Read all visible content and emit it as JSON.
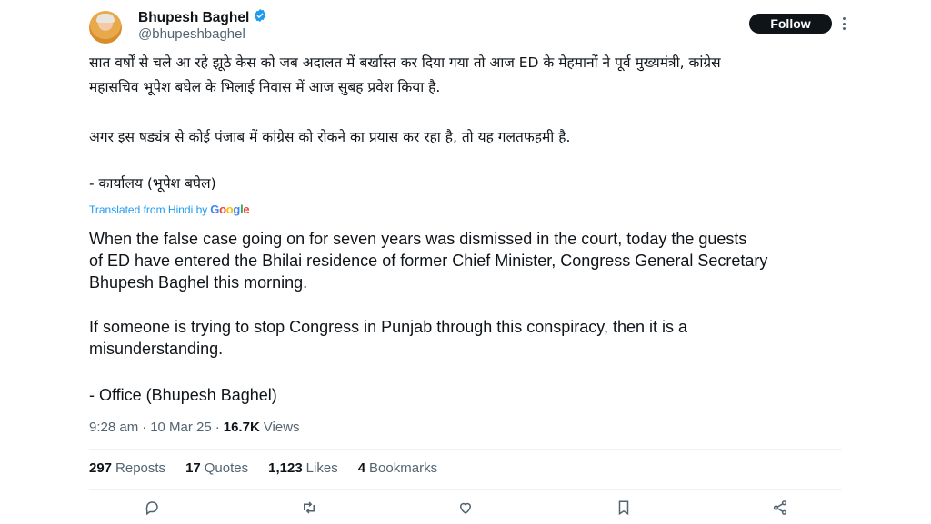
{
  "author": {
    "display_name": "Bhupesh Baghel",
    "handle": "@bhupeshbaghel"
  },
  "follow_label": "Follow",
  "original_text": {
    "line1": "सात वर्षों से चले आ रहे झूठे केस को जब अदालत में बर्खास्त कर दिया गया तो आज ED के मेहमानों ने पूर्व मुख्यमंत्री, कांग्रेस",
    "line2": "महासचिव भूपेश बघेल के भिलाई निवास में आज सुबह प्रवेश किया है.",
    "line3": "अगर इस षड्यंत्र से कोई पंजाब में कांग्रेस को रोकने का प्रयास कर रहा है, तो यह गलतफहमी है.",
    "line4": "- कार्यालय (भूपेश बघेल)"
  },
  "translation": {
    "label": "Translated from Hindi by",
    "provider": "Google",
    "line1": "When the false case going on for seven years was dismissed in the court, today the guests",
    "line2": "of ED have entered the Bhilai residence of former Chief Minister, Congress General Secretary",
    "line3": "Bhupesh Baghel this morning.",
    "line4": "If someone is trying to stop Congress in Punjab through this conspiracy, then it is a",
    "line5": "misunderstanding.",
    "line6": "- Office (Bhupesh Baghel)"
  },
  "meta": {
    "time": "9:28 am",
    "separator": "·",
    "date": "10 Mar 25",
    "views_count": "16.7K",
    "views_label": "Views"
  },
  "stats": {
    "reposts_count": "297",
    "reposts_label": "Reposts",
    "quotes_count": "17",
    "quotes_label": "Quotes",
    "likes_count": "1,123",
    "likes_label": "Likes",
    "bookmarks_count": "4",
    "bookmarks_label": "Bookmarks"
  },
  "icons": {
    "verified": "verified-badge-icon",
    "more": "more-options-icon",
    "reply": "reply-icon",
    "repost": "repost-icon",
    "like": "like-icon",
    "bookmark": "bookmark-icon",
    "share": "share-icon"
  },
  "colors": {
    "accent": "#1d9bf0",
    "text_primary": "#0f1419",
    "text_secondary": "#536471",
    "follow_bg": "#0f1419"
  }
}
